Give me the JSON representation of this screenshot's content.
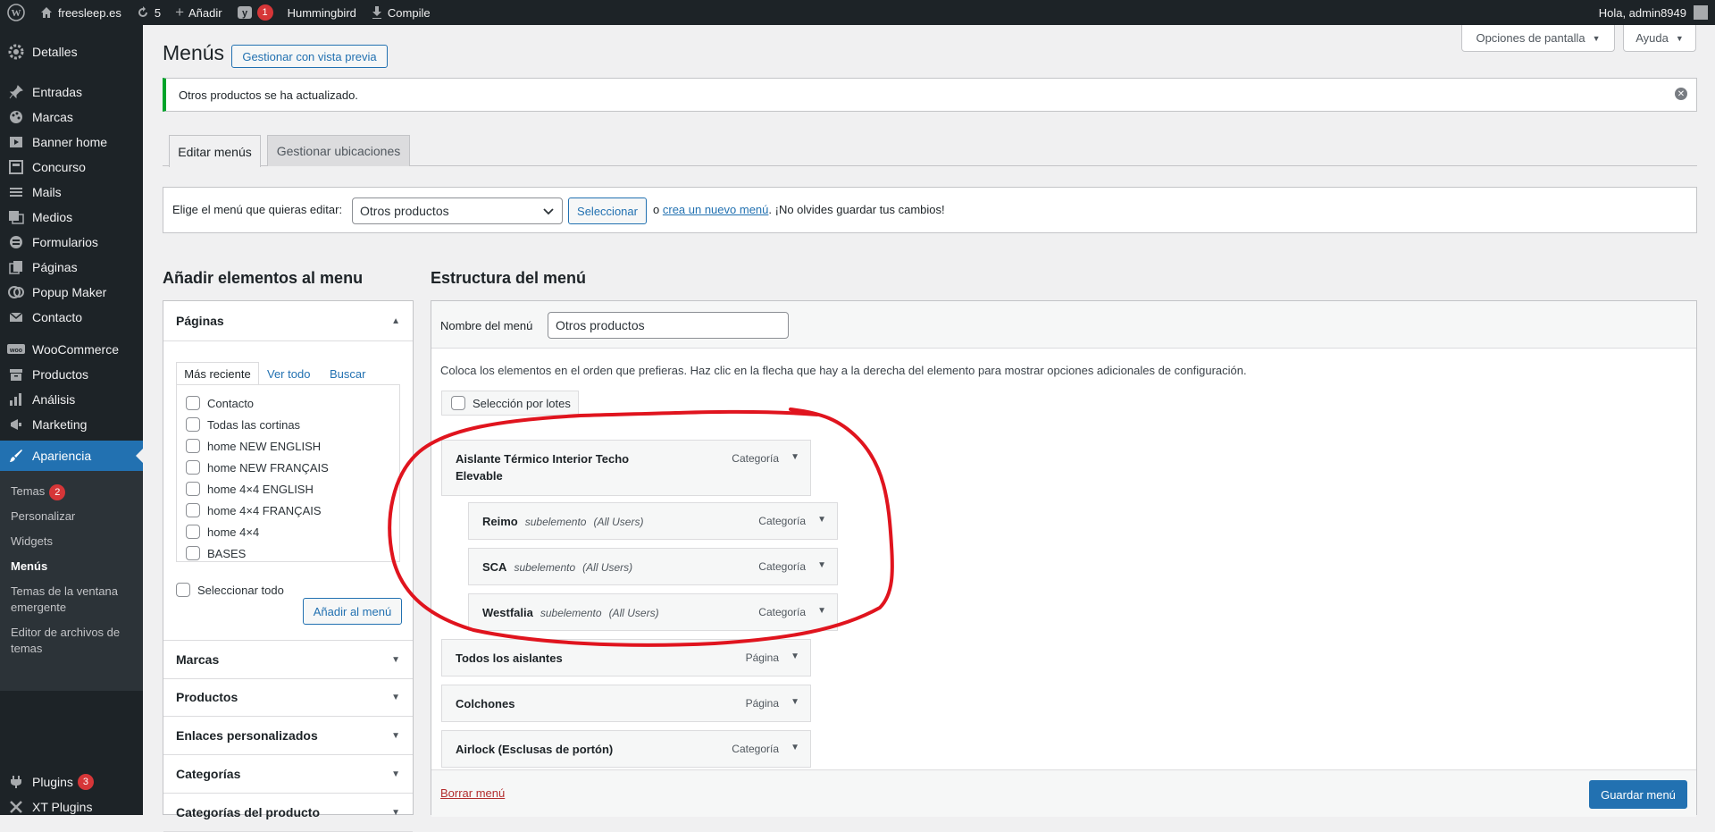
{
  "adminbar": {
    "site_name": "freesleep.es",
    "updates_count": "5",
    "new_label": "Añadir",
    "yoast_badge": "1",
    "hummingbird_label": "Hummingbird",
    "compile_label": "Compile",
    "greeting": "Hola, admin8949"
  },
  "sidebar": {
    "items": [
      {
        "label": "Detalles",
        "icon": "dashboard-icon"
      },
      {
        "label": "Entradas",
        "icon": "pin-icon"
      },
      {
        "label": "Marcas",
        "icon": "palette-icon"
      },
      {
        "label": "Banner home",
        "icon": "video-icon"
      },
      {
        "label": "Concurso",
        "icon": "admin-page-icon"
      },
      {
        "label": "Mails",
        "icon": "list-icon"
      },
      {
        "label": "Medios",
        "icon": "media-icon"
      },
      {
        "label": "Formularios",
        "icon": "forms-icon"
      },
      {
        "label": "Páginas",
        "icon": "pages-icon"
      },
      {
        "label": "Popup Maker",
        "icon": "popup-icon"
      },
      {
        "label": "Contacto",
        "icon": "mail-icon"
      },
      {
        "label": "WooCommerce",
        "icon": "woo-icon"
      },
      {
        "label": "Productos",
        "icon": "archive-icon"
      },
      {
        "label": "Análisis",
        "icon": "chart-icon"
      },
      {
        "label": "Marketing",
        "icon": "megaphone-icon"
      },
      {
        "label": "Apariencia",
        "icon": "brush-icon"
      },
      {
        "label": "Plugins",
        "icon": "plugin-icon",
        "badge": "3"
      },
      {
        "label": "XT Plugins",
        "icon": "xt-icon"
      }
    ],
    "submenu": [
      {
        "label": "Temas",
        "badge": "2"
      },
      {
        "label": "Personalizar"
      },
      {
        "label": "Widgets"
      },
      {
        "label": "Menús"
      },
      {
        "label": "Temas de la ventana emergente"
      },
      {
        "label": "Editor de archivos de temas"
      }
    ]
  },
  "header": {
    "title": "Menús",
    "preview_button": "Gestionar con vista previa",
    "screen_options": "Opciones de pantalla",
    "help": "Ayuda"
  },
  "notice": {
    "strong": "Otros productos",
    "text": " se ha actualizado."
  },
  "tabs": [
    "Editar menús",
    "Gestionar ubicaciones"
  ],
  "manage": {
    "label": "Elige el menú que quieras editar:",
    "selected": "Otros productos",
    "select_button": "Seleccionar",
    "or": "o",
    "create_link": "crea un nuevo menú",
    "reminder": ". ¡No olvides guardar tus cambios!"
  },
  "add_items": {
    "heading": "Añadir elementos al menu",
    "pages_title": "Páginas",
    "inner_tabs": [
      "Más reciente",
      "Ver todo",
      "Buscar"
    ],
    "pages": [
      "Contacto",
      "Todas las cortinas",
      "home NEW ENGLISH",
      "home NEW FRANÇAIS",
      "home 4×4 ENGLISH",
      "home 4×4 FRANÇAIS",
      "home 4×4",
      "BASES"
    ],
    "select_all": "Seleccionar todo",
    "add_button": "Añadir al menú",
    "sections": [
      "Marcas",
      "Productos",
      "Enlaces personalizados",
      "Categorías",
      "Categorías del producto"
    ]
  },
  "structure": {
    "heading": "Estructura del menú",
    "name_label": "Nombre del menú",
    "name_value": "Otros productos",
    "instructions": "Coloca los elementos en el orden que prefieras. Haz clic en la flecha que hay a la derecha del elemento para mostrar opciones adicionales de configuración.",
    "bulk_select": "Selección por lotes",
    "items": [
      {
        "title_line1": "Aislante Térmico Interior Techo",
        "title_line2": "Elevable",
        "type": "Categoría"
      },
      {
        "title": "Reimo",
        "sub": "subelemento",
        "users": "(All Users)",
        "type": "Categoría"
      },
      {
        "title": "SCA",
        "sub": "subelemento",
        "users": "(All Users)",
        "type": "Categoría"
      },
      {
        "title": "Westfalia",
        "sub": "subelemento",
        "users": "(All Users)",
        "type": "Categoría"
      },
      {
        "title": "Todos los aislantes",
        "type": "Página"
      },
      {
        "title": "Colchones",
        "type": "Página"
      },
      {
        "title": "Airlock (Esclusas de portón)",
        "type": "Categoría"
      }
    ],
    "delete_link": "Borrar menú",
    "save_button": "Guardar menú"
  },
  "colors": {
    "accent": "#2271b1",
    "sidebar_bg": "#1d2327",
    "annotation": "#e0141e",
    "success": "#00a32a",
    "badge": "#d63638"
  }
}
